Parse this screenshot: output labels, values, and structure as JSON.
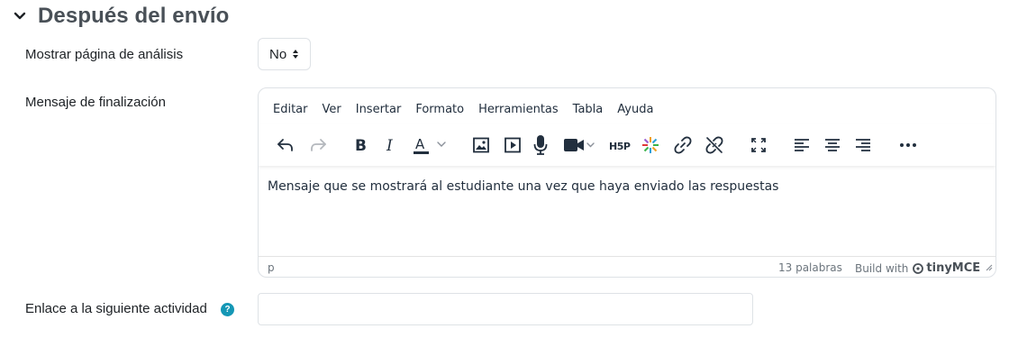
{
  "section": {
    "title": "Después del envío"
  },
  "fields": {
    "analysis_label": "Mostrar página de análisis",
    "analysis_value": "No",
    "completion_label": "Mensaje de finalización",
    "next_activity_label": "Enlace a la siguiente actividad",
    "next_activity_value": ""
  },
  "editor": {
    "menu": [
      "Editar",
      "Ver",
      "Insertar",
      "Formato",
      "Herramientas",
      "Tabla",
      "Ayuda"
    ],
    "content": "Mensaje que se mostrará al estudiante una vez que haya enviado las respuestas",
    "status_path": "p",
    "word_count": "13 palabras",
    "build_with": "Build with",
    "brand": "tinyMCE",
    "toolbar_icons": [
      "undo-icon",
      "redo-icon",
      "bold-icon",
      "italic-icon",
      "text-color-icon",
      "image-icon",
      "media-icon",
      "record-audio-icon",
      "record-video-icon",
      "h5p-icon",
      "special-chars-icon",
      "link-icon",
      "unlink-icon",
      "fullscreen-icon",
      "align-left-icon",
      "align-center-icon",
      "align-right-icon",
      "more-icon"
    ],
    "text_color_letter": "A"
  },
  "help_icon": "?",
  "colors": {
    "accent": "#1497b5",
    "text": "#1d2125",
    "header": "#495057"
  }
}
